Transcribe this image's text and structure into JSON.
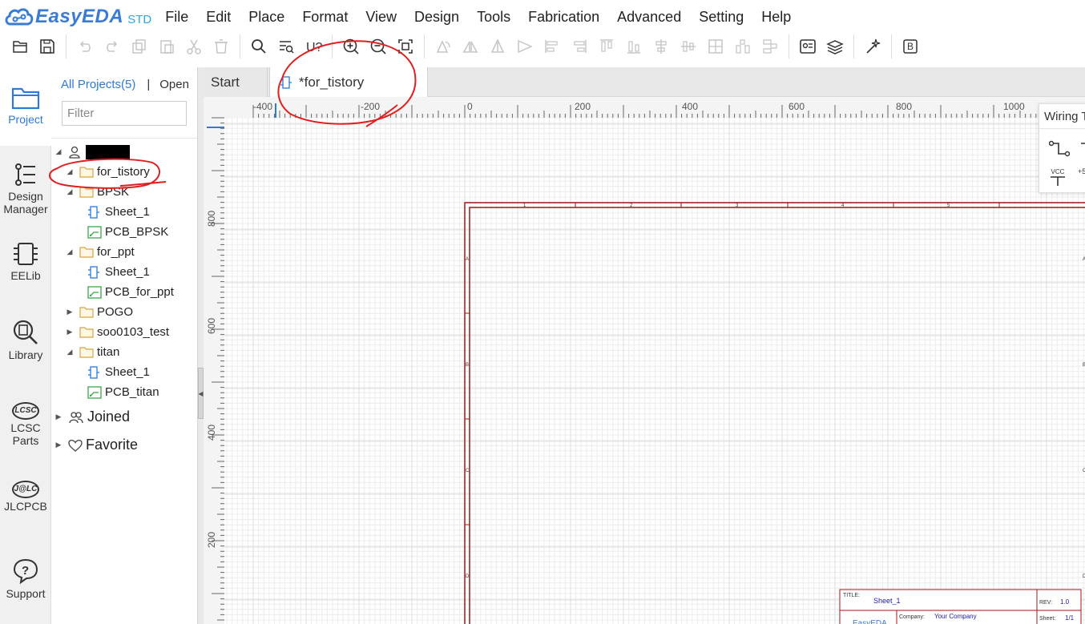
{
  "app": {
    "logo_text": "EasyEDA",
    "edition": "STD",
    "brand_color": "#3a7bd5",
    "accent_color": "#2d7bd6"
  },
  "menu": [
    "File",
    "Edit",
    "Place",
    "Format",
    "View",
    "Design",
    "Tools",
    "Fabrication",
    "Advanced",
    "Setting",
    "Help"
  ],
  "toolbar": {
    "groups": [
      [
        {
          "icon": "open-folder-icon",
          "enabled": true
        },
        {
          "icon": "save-icon",
          "enabled": true
        }
      ],
      [
        {
          "icon": "undo-icon",
          "enabled": false
        },
        {
          "icon": "redo-icon",
          "enabled": false
        },
        {
          "icon": "copy-icon",
          "enabled": false
        },
        {
          "icon": "paste-icon",
          "enabled": false
        },
        {
          "icon": "cut-icon",
          "enabled": false
        },
        {
          "icon": "delete-icon",
          "enabled": false
        }
      ],
      [
        {
          "icon": "search-icon",
          "enabled": true
        },
        {
          "icon": "netlist-search-icon",
          "enabled": true
        },
        {
          "icon": "annotate-icon",
          "enabled": true
        }
      ],
      [
        {
          "icon": "zoom-in-icon",
          "enabled": true
        },
        {
          "icon": "zoom-out-icon",
          "enabled": true
        },
        {
          "icon": "fit-view-icon",
          "enabled": true
        }
      ],
      [
        {
          "icon": "rotate-icon",
          "enabled": false
        },
        {
          "icon": "flip-horizontal-icon",
          "enabled": false
        },
        {
          "icon": "flip-vertical-icon",
          "enabled": false
        },
        {
          "icon": "send-icon",
          "enabled": false
        },
        {
          "icon": "align-left-icon",
          "enabled": false
        },
        {
          "icon": "align-right-icon",
          "enabled": false
        },
        {
          "icon": "align-top-icon",
          "enabled": false
        },
        {
          "icon": "align-bottom-icon",
          "enabled": false
        },
        {
          "icon": "align-center-h-icon",
          "enabled": false
        },
        {
          "icon": "align-center-v-icon",
          "enabled": false
        },
        {
          "icon": "align-grid-icon",
          "enabled": false
        },
        {
          "icon": "distribute-h-icon",
          "enabled": false
        },
        {
          "icon": "distribute-v-icon",
          "enabled": false
        }
      ],
      [
        {
          "icon": "image-icon",
          "enabled": true
        },
        {
          "icon": "layers-export-icon",
          "enabled": true
        }
      ],
      [
        {
          "icon": "wand-icon",
          "enabled": true
        }
      ],
      [
        {
          "icon": "bom-icon",
          "enabled": true
        }
      ]
    ],
    "bom_glyph": "B"
  },
  "leftbar": [
    {
      "label": "Project",
      "icon": "folder-icon",
      "active": true
    },
    {
      "label": "Design Manager",
      "icon": "list-icon",
      "active": false
    },
    {
      "label": "EELib",
      "icon": "chip-icon",
      "active": false
    },
    {
      "label": "Library",
      "icon": "library-search-icon",
      "active": false
    },
    {
      "label": "LCSC Parts",
      "icon": "lcsc-logo-icon",
      "active": false
    },
    {
      "label": "JLCPCB",
      "icon": "jlc-logo-icon",
      "active": false
    },
    {
      "label": "Support",
      "icon": "help-icon",
      "active": false
    }
  ],
  "leftbar_logos": {
    "lcsc": "LCSC",
    "jlc": "J@LC"
  },
  "panel": {
    "all_projects": "All Projects(5)",
    "separator": "|",
    "open": "Open",
    "filter_placeholder": "Filter",
    "tree": [
      {
        "label": "",
        "type": "user",
        "level": 0,
        "expanded": true
      },
      {
        "label": "for_tistory",
        "type": "folder",
        "level": 1,
        "expanded": true
      },
      {
        "label": "BPSK",
        "type": "folder",
        "level": 1,
        "expanded": true
      },
      {
        "label": "Sheet_1",
        "type": "sheet",
        "level": 2
      },
      {
        "label": "PCB_BPSK",
        "type": "pcb",
        "level": 2
      },
      {
        "label": "for_ppt",
        "type": "folder",
        "level": 1,
        "expanded": true
      },
      {
        "label": "Sheet_1",
        "type": "sheet",
        "level": 2
      },
      {
        "label": "PCB_for_ppt",
        "type": "pcb",
        "level": 2
      },
      {
        "label": "POGO",
        "type": "folder",
        "level": 1,
        "expanded": false
      },
      {
        "label": "soo0103_test",
        "type": "folder",
        "level": 1,
        "expanded": false
      },
      {
        "label": "titan",
        "type": "folder",
        "level": 1,
        "expanded": true
      },
      {
        "label": "Sheet_1",
        "type": "sheet",
        "level": 2
      },
      {
        "label": "PCB_titan",
        "type": "pcb",
        "level": 2
      },
      {
        "label": "Joined",
        "type": "group",
        "level": 0,
        "expanded": false
      },
      {
        "label": "Favorite",
        "type": "heart",
        "level": 0,
        "expanded": false
      }
    ]
  },
  "tabs": [
    {
      "label": "Start",
      "active": false
    },
    {
      "label": "*for_tistory",
      "active": true,
      "icon": "schematic-icon"
    }
  ],
  "ruler": {
    "h_labels": [
      "-400",
      "-200",
      "0",
      "200",
      "400",
      "600",
      "800",
      "1000"
    ],
    "v_labels": [
      "800",
      "600",
      "400",
      "200"
    ]
  },
  "sheet": {
    "col_labels": [
      "1",
      "2",
      "3",
      "4",
      "5"
    ],
    "row_labels": [
      "A",
      "B",
      "C",
      "D"
    ],
    "frame_color": "#a01818",
    "title_block": {
      "title_label": "TITLE:",
      "title_value": "Sheet_1",
      "rev_label": "REV:",
      "rev_value": "1.0",
      "company_label": "Company:",
      "company_value": "Your Company",
      "sheet_label": "Sheet:",
      "sheet_value": "1/1",
      "logo": "EasyEDA"
    }
  },
  "wiring_panel": {
    "title": "Wiring T",
    "vcc_label": "VCC",
    "plus_label": "+5"
  }
}
